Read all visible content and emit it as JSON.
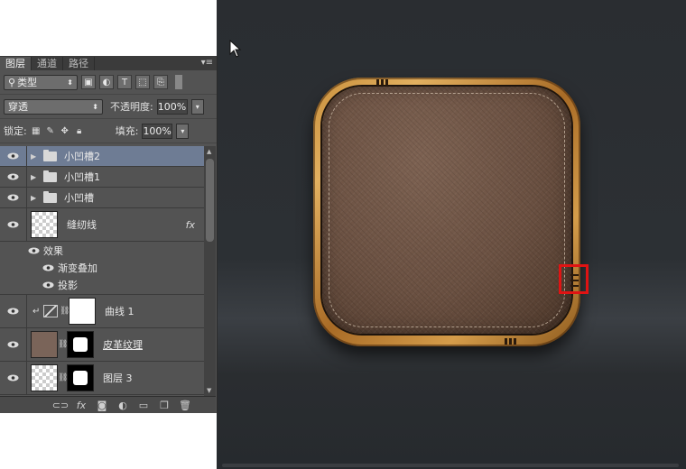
{
  "panel": {
    "tabs": [
      "图层",
      "通道",
      "路径"
    ],
    "filter": {
      "kind_label": "类型"
    },
    "blend_mode": "穿透",
    "opacity_label": "不透明度:",
    "opacity_value": "100%",
    "lock_label": "锁定:",
    "fill_label": "填充:",
    "fill_value": "100%",
    "filter_icon_labels": [
      "T"
    ],
    "layers": [
      {
        "name": "小凹槽2",
        "type": "group",
        "selected": true
      },
      {
        "name": "小凹槽1",
        "type": "group"
      },
      {
        "name": "小凹槽",
        "type": "group"
      },
      {
        "name": "缝纫线",
        "type": "layer-with-effects",
        "fx": "fx"
      },
      {
        "name": "效果",
        "type": "effect-header"
      },
      {
        "name": "渐变叠加",
        "type": "effect"
      },
      {
        "name": "投影",
        "type": "effect"
      },
      {
        "name": "曲线 1",
        "type": "adjustment"
      },
      {
        "name": "皮革纹理",
        "type": "masked"
      },
      {
        "name": "图层 3",
        "type": "masked"
      }
    ],
    "bottom_icons": [
      "link-icon",
      "fx-icon",
      "mask-icon",
      "adjustment-icon",
      "new-group-icon",
      "new-layer-icon",
      "trash-icon"
    ],
    "bottom_fx_label": "fx"
  },
  "colors": {
    "panel_bg": "#535353",
    "selected_row": "#6e7c94",
    "highlight_box": "#e01313"
  }
}
